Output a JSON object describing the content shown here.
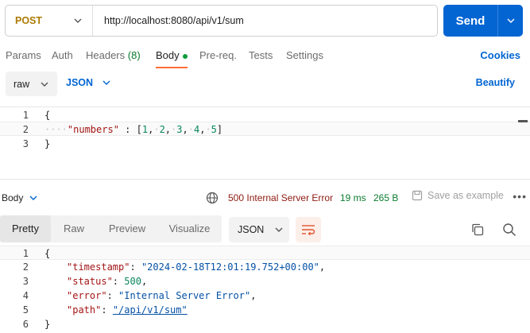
{
  "request": {
    "method": "POST",
    "url": "http://localhost:8080/api/v1/sum",
    "send_label": "Send"
  },
  "request_tabs": [
    {
      "label": "Params"
    },
    {
      "label": "Auth"
    },
    {
      "label": "Headers",
      "count": "(8)"
    },
    {
      "label": "Body",
      "active": true
    },
    {
      "label": "Pre-req."
    },
    {
      "label": "Tests"
    },
    {
      "label": "Settings"
    }
  ],
  "cookies_label": "Cookies",
  "body_options": {
    "mode": "raw",
    "format": "JSON",
    "beautify_label": "Beautify"
  },
  "request_body": {
    "line_numbers": [
      "1",
      "2",
      "3"
    ],
    "open_brace": "{",
    "key": "\"numbers\"",
    "colon": " : ",
    "values": [
      "1",
      "2",
      "3",
      "4",
      "5"
    ],
    "close_brace": "}"
  },
  "response_bar": {
    "body_label": "Body",
    "status": "500 Internal Server Error",
    "time": "19 ms",
    "size": "265 B",
    "save_label": "Save as example",
    "more": "•••"
  },
  "response_tabs": [
    {
      "label": "Pretty",
      "active": true
    },
    {
      "label": "Raw"
    },
    {
      "label": "Preview"
    },
    {
      "label": "Visualize"
    }
  ],
  "response_format": "JSON",
  "response_body": {
    "line_numbers": [
      "1",
      "2",
      "3",
      "4",
      "5",
      "6"
    ],
    "open_brace": "{",
    "lines": [
      {
        "key": "\"timestamp\"",
        "value": "\"2024-02-18T12:01:19.752+00:00\"",
        "type": "string",
        "trail": ","
      },
      {
        "key": "\"status\"",
        "value": "500",
        "type": "number",
        "trail": ","
      },
      {
        "key": "\"error\"",
        "value": "\"Internal Server Error\"",
        "type": "string",
        "trail": ","
      },
      {
        "key": "\"path\"",
        "value": "\"/api/v1/sum\"",
        "type": "link",
        "trail": ""
      }
    ],
    "close_brace": "}"
  },
  "colors": {
    "accent": "#0265d2",
    "method": "#ad7a03",
    "error_status": "#8e1a10",
    "success": "#0a7b2e",
    "active_tab_underline": "#ff6c37"
  }
}
